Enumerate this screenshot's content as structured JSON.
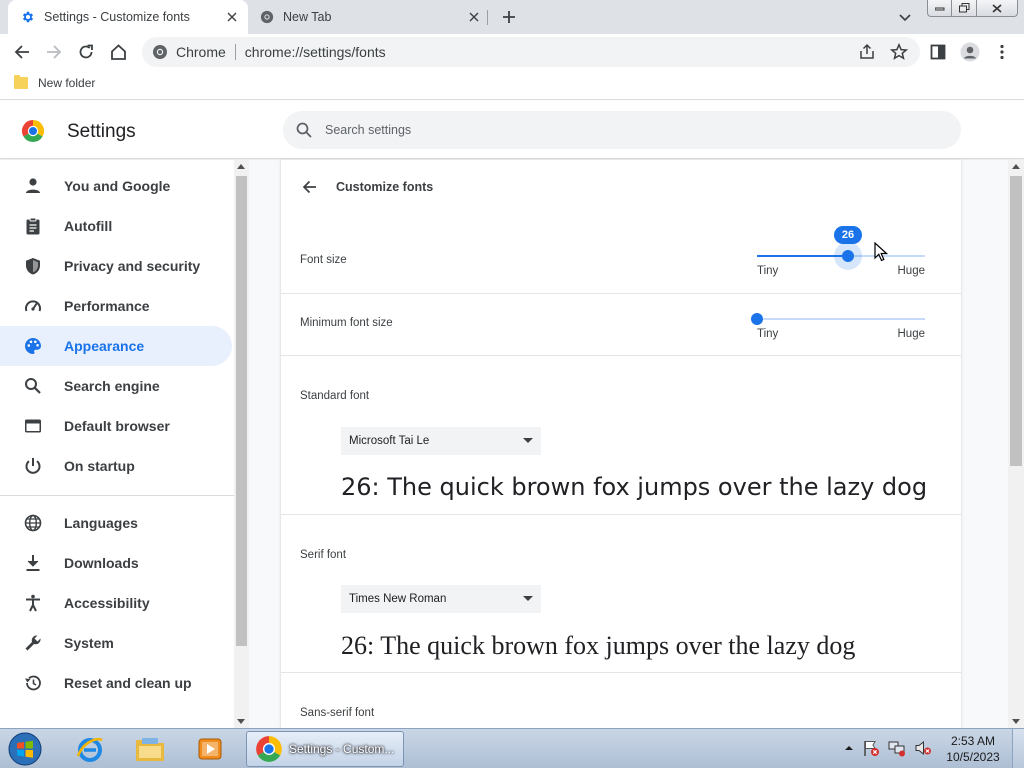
{
  "browser": {
    "tabs": [
      {
        "title": "Settings - Customize fonts",
        "active": true
      },
      {
        "title": "New Tab",
        "active": false
      }
    ],
    "omnibox": {
      "chip": "Chrome",
      "url": "chrome://settings/fonts"
    },
    "bookmarks": [
      {
        "label": "New folder"
      }
    ]
  },
  "settings": {
    "title": "Settings",
    "search_placeholder": "Search settings"
  },
  "sidebar": {
    "items": [
      {
        "label": "You and Google",
        "icon": "person-icon",
        "selected": false
      },
      {
        "label": "Autofill",
        "icon": "clipboard-icon",
        "selected": false
      },
      {
        "label": "Privacy and security",
        "icon": "shield-icon",
        "selected": false
      },
      {
        "label": "Performance",
        "icon": "speedometer-icon",
        "selected": false
      },
      {
        "label": "Appearance",
        "icon": "palette-icon",
        "selected": true
      },
      {
        "label": "Search engine",
        "icon": "search-icon",
        "selected": false
      },
      {
        "label": "Default browser",
        "icon": "browser-icon",
        "selected": false
      },
      {
        "label": "On startup",
        "icon": "power-icon",
        "selected": false
      },
      {
        "label": "Languages",
        "icon": "globe-icon",
        "selected": false
      },
      {
        "label": "Downloads",
        "icon": "download-icon",
        "selected": false
      },
      {
        "label": "Accessibility",
        "icon": "accessibility-icon",
        "selected": false
      },
      {
        "label": "System",
        "icon": "wrench-icon",
        "selected": false
      },
      {
        "label": "Reset and clean up",
        "icon": "restore-icon",
        "selected": false
      }
    ]
  },
  "page": {
    "title": "Customize fonts",
    "font_size": {
      "label": "Font size",
      "value": "26",
      "level": 0.54,
      "min_label": "Tiny",
      "max_label": "Huge"
    },
    "minimum_font_size": {
      "label": "Minimum font size",
      "level": 0,
      "min_label": "Tiny",
      "max_label": "Huge"
    },
    "standard_font": {
      "label": "Standard font",
      "selected": "Microsoft Tai Le",
      "sample": "26: The quick brown fox jumps over the lazy dog"
    },
    "serif_font": {
      "label": "Serif font",
      "selected": "Times New Roman",
      "sample": "26: The quick brown fox jumps over the lazy dog"
    },
    "sans_serif_font": {
      "label": "Sans-serif font"
    }
  },
  "taskbar": {
    "chrome_label": "Settings - Custom...",
    "time": "2:53 AM",
    "date": "10/5/2023"
  },
  "colors": {
    "accent": "#1a73e8",
    "selected_bg": "#e8f0fe"
  }
}
